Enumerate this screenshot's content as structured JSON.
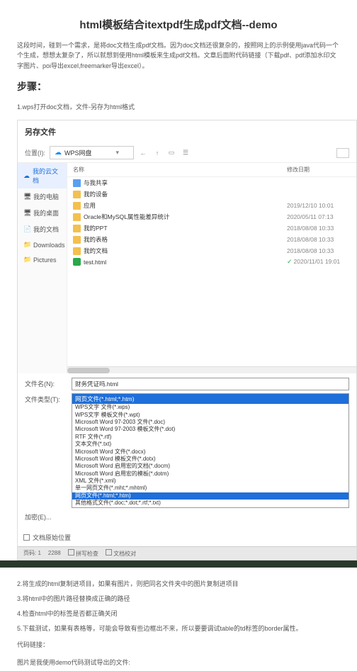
{
  "title": "html模板结合itextpdf生成pdf文档--demo",
  "intro": "这段时间，碰到一个需求，是将doc文档生成pdf文档。因为doc文档还很复杂的，按照网上的示例使用java代码一个个生成，想想太复杂了，所以就想到使用html模板来生成pdf文档。文章后面附代码链接（下载pdf、pdf添加水印文字图片、poi导出excel,freemarker导出excel）。",
  "stepsHeading": "步骤：",
  "step1": "1.wps打开doc文档，文件-另存为html格式",
  "dialog": {
    "title": "另存文件",
    "locLabel": "位置(I):",
    "locValue": "WPS网盘",
    "sidebar": [
      {
        "label": "我的云文档",
        "icon": "☁",
        "active": true
      },
      {
        "label": "我的电脑",
        "icon": "🖥"
      },
      {
        "label": "我的桌面",
        "icon": "🖥"
      },
      {
        "label": "我的文档",
        "icon": "📄"
      },
      {
        "label": "Downloads",
        "icon": "📁"
      },
      {
        "label": "Pictures",
        "icon": "📁"
      }
    ],
    "cols": {
      "name": "名称",
      "date": "修改日期"
    },
    "files": [
      {
        "name": "与我共享",
        "date": "",
        "ico": "ico-folder-share"
      },
      {
        "name": "我的设备",
        "date": "",
        "ico": "ico-folder"
      },
      {
        "name": "应用",
        "date": "2019/12/10 10:01",
        "ico": "ico-folder"
      },
      {
        "name": "Oracle和MySQL属性能差异统计",
        "date": "2020/05/11 07:13",
        "ico": "ico-folder"
      },
      {
        "name": "我的PPT",
        "date": "2018/08/08 10:33",
        "ico": "ico-folder"
      },
      {
        "name": "我的表格",
        "date": "2018/08/08 10:33",
        "ico": "ico-folder"
      },
      {
        "name": "我的文档",
        "date": "2018/08/08 10:33",
        "ico": "ico-folder"
      },
      {
        "name": "test.html",
        "date": "2020/11/01 19:01",
        "ico": "ico-html",
        "check": true
      }
    ],
    "fnameLabel": "文件名(N):",
    "fnameValue": "财务凭证吗.html",
    "ftypeLabel": "文件类型(T):",
    "ftypeSelected": "网页文件(*.html;*.htm)",
    "typeOptions": [
      "WPS文字 文件(*.wps)",
      "WPS文字 模板文件(*.wpt)",
      "Microsoft Word 97-2003 文件(*.doc)",
      "Microsoft Word 97-2003 模板文件(*.dot)",
      "RTF 文件(*.rtf)",
      "文本文件(*.txt)",
      "Microsoft Word 文件(*.docx)",
      "Microsoft Word 模板文件(*.dotx)",
      "Microsoft Word 启用宏的文档(*.docm)",
      "Microsoft Word 启用宏的模板(*.dotm)",
      "XML 文件(*.xml)",
      "单一网页文件(*.mht;*.mhtml)",
      "网页文件(*.html;*.htm)",
      "其他格式文件(*.doc;*.dot;*.rtf;*.txt)"
    ],
    "encLabel": "加密(E)...",
    "encSave": "文档原始位置"
  },
  "status": {
    "page": "页码: 1",
    "zoom": "2288",
    "b1": "拼写检查",
    "b2": "文档校对"
  },
  "step2": "2.将生成的html复制进项目，如果有图片，则把同名文件夹中的图片复制进项目",
  "step3": "3.将html中的图片路径替换成正确的路径",
  "step4": "4.检查html中的标签是否都正确关闭",
  "step5": "5.下载测试，如果有表格等，可能会导致有些边框出不来，所以要要调试table的td标签的border属性。",
  "codeLabel": "代码链接：",
  "imgLabel": "图片是我使用demo代码测试导出的文件:"
}
